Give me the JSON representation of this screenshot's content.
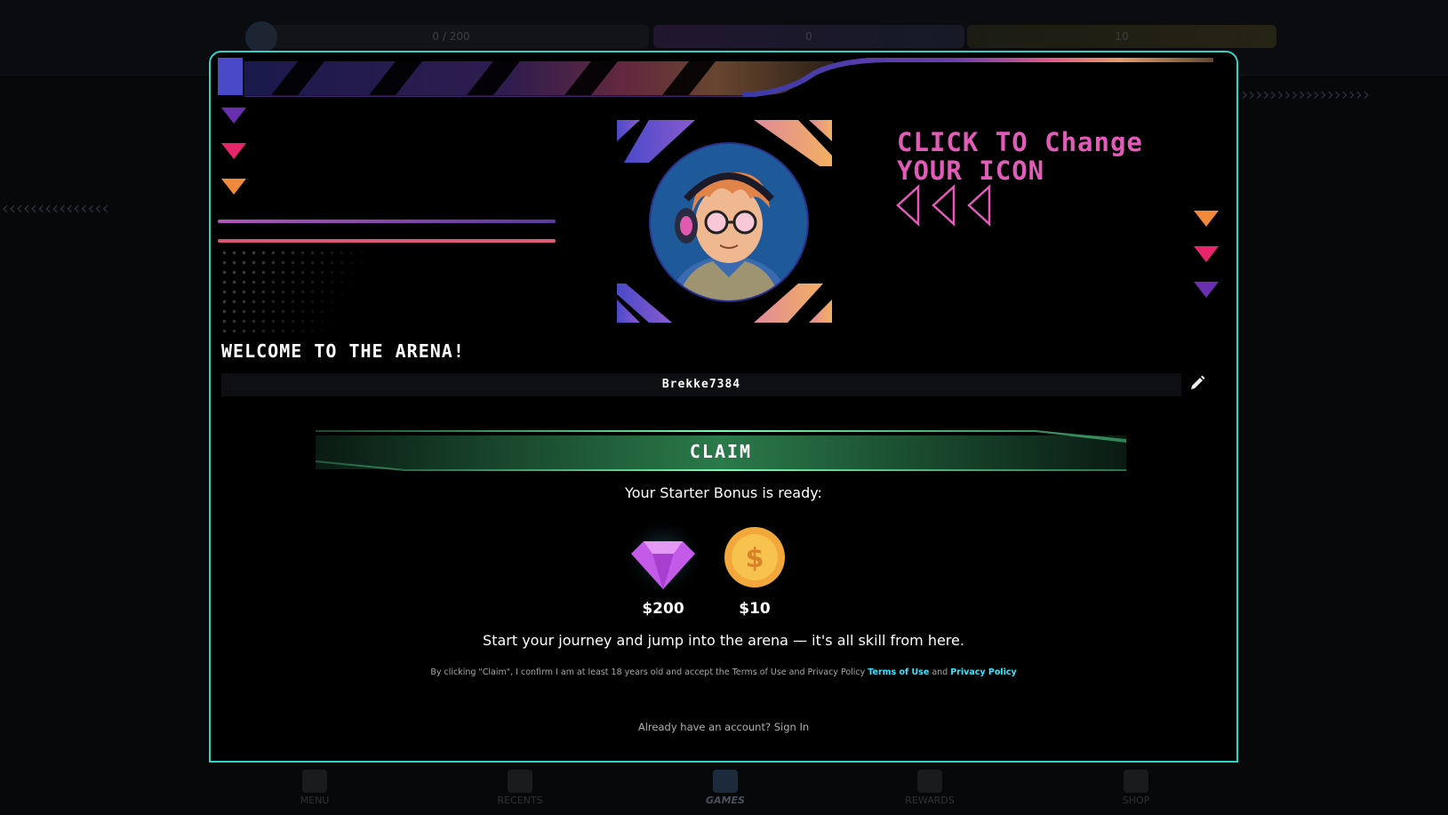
{
  "top_bar": {
    "gems_progress": "0 / 200",
    "mid_value": "0",
    "coins_value": "10"
  },
  "bottom_nav": {
    "items": [
      {
        "label": "MENU",
        "icon": "menu-icon"
      },
      {
        "label": "RECENTS",
        "icon": "clipboard-icon"
      },
      {
        "label": "GAMES",
        "icon": "cards-icon",
        "active": true
      },
      {
        "label": "REWARDS",
        "icon": "gift-icon"
      },
      {
        "label": "SHOP",
        "icon": "shop-icon"
      }
    ]
  },
  "modal": {
    "change_icon_line1": "CLICK TO Change",
    "change_icon_line2": "YOUR ICON",
    "welcome": "WELCOME TO THE ARENA!",
    "username": "Brekke7384",
    "claim_label": "CLAIM",
    "bonus_ready": "Your Starter Bonus is ready:",
    "rewards": [
      {
        "type": "gem-icon",
        "amount": "$200"
      },
      {
        "type": "coin-icon",
        "amount": "$10"
      }
    ],
    "journey_text": "Start your journey and jump into the arena — it's all skill from here.",
    "legal_prefix": "By clicking \"Claim\", I confirm I am at least 18 years old and accept the Terms of Use and Privacy Policy ",
    "terms_link": "Terms of Use",
    "legal_and": " and ",
    "privacy_link": "Privacy Policy",
    "signin_text": "Already have an account? Sign In"
  },
  "colors": {
    "accent_border": "#2fd3c6",
    "claim_green": "#58e79a",
    "title_pink": "#e35bb8",
    "link_cyan": "#3fe3ff"
  }
}
